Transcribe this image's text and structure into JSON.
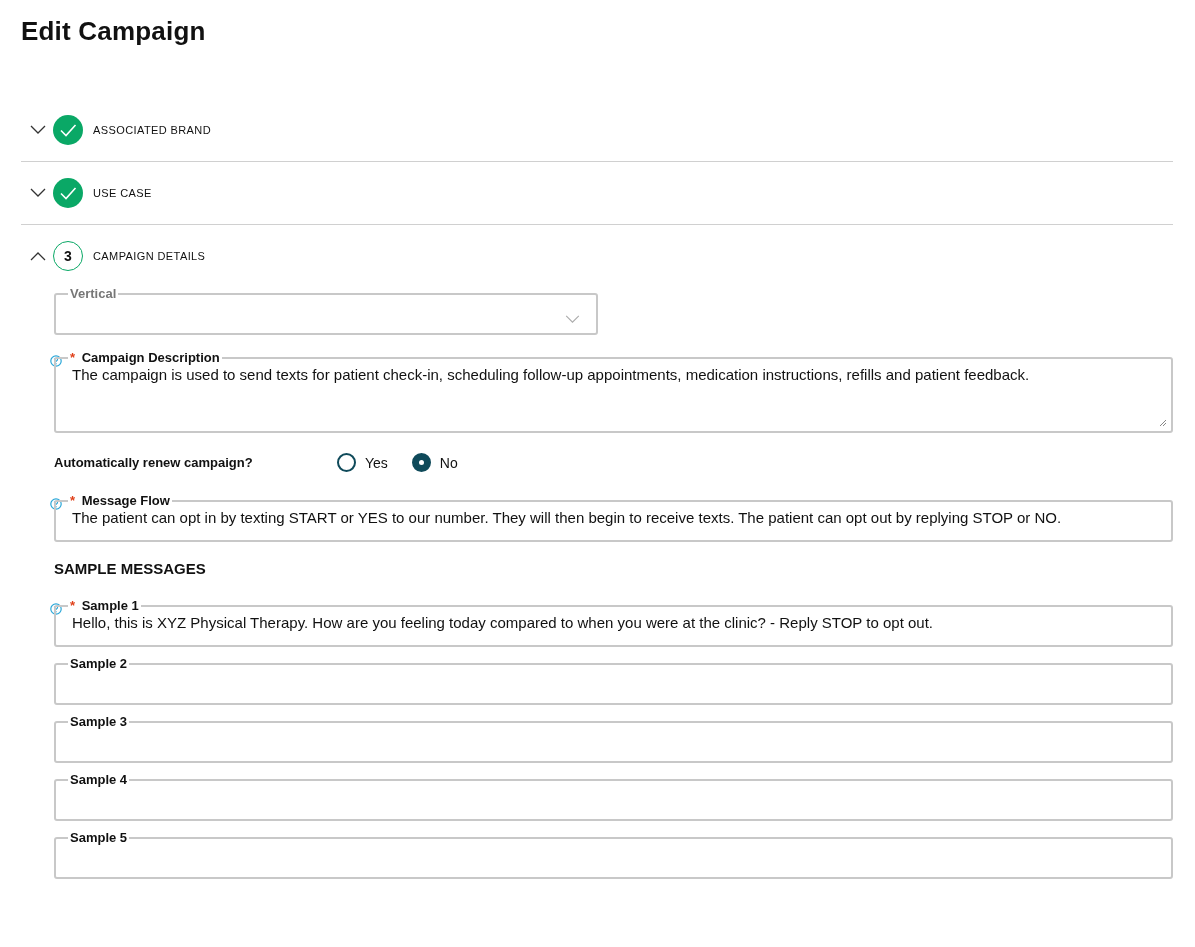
{
  "title": "Edit Campaign",
  "steps": [
    {
      "label": "ASSOCIATED BRAND",
      "completed": true,
      "expanded": false
    },
    {
      "label": "USE CASE",
      "completed": true,
      "expanded": false
    },
    {
      "label": "CAMPAIGN DETAILS",
      "completed": false,
      "expanded": true,
      "number": "3"
    }
  ],
  "vertical": {
    "label": "Vertical",
    "disabled": true
  },
  "description": {
    "label": "Campaign Description",
    "required_mark": "*",
    "help": true,
    "value": "The campaign is used to send texts for patient check-in, scheduling follow-up appointments, medication instructions, refills and patient feedback."
  },
  "renew": {
    "question": "Automatically renew campaign?",
    "options": [
      {
        "label": "Yes",
        "selected": false
      },
      {
        "label": "No",
        "selected": true
      }
    ]
  },
  "message_flow": {
    "label": "Message Flow",
    "required_mark": "*",
    "help": true,
    "value": "The patient can opt in by texting START or YES to our number. They will then begin to receive texts. The patient can opt out by replying STOP or NO."
  },
  "sample_heading": "SAMPLE MESSAGES",
  "samples": [
    {
      "label": "Sample 1",
      "required_mark": "*",
      "help": true,
      "value": "Hello, this is XYZ Physical Therapy. How are you feeling today compared to when you were at the clinic?  - Reply STOP to opt out."
    },
    {
      "label": "Sample 2",
      "help": false
    },
    {
      "label": "Sample 3",
      "help": false
    },
    {
      "label": "Sample 4",
      "help": false
    },
    {
      "label": "Sample 5",
      "help": false
    }
  ]
}
